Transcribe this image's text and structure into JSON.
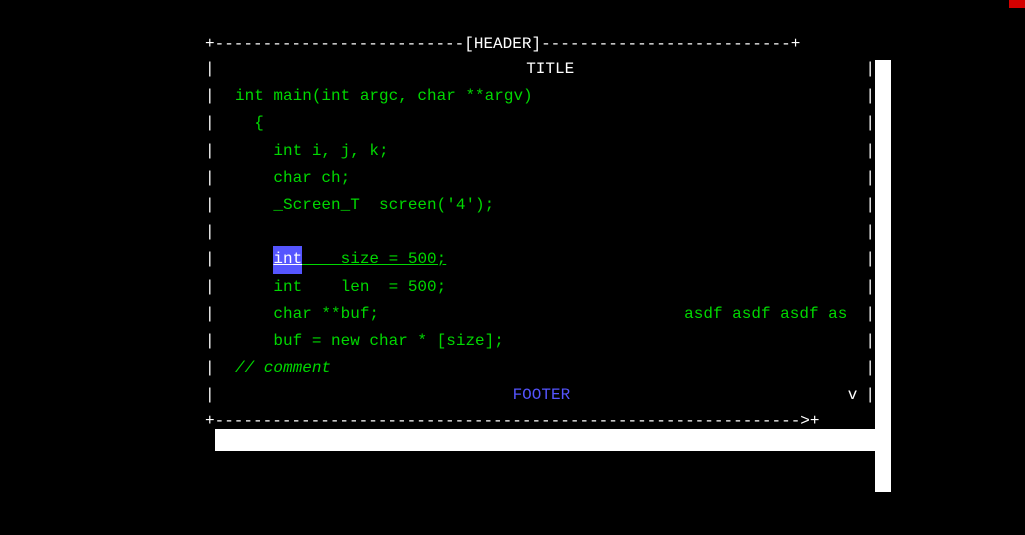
{
  "header": {
    "label": "[HEADER]"
  },
  "title": "TITLE",
  "footer": "FOOTER",
  "scroll_down": "v",
  "code": {
    "line1": "int main(int argc, char **argv)",
    "line2": "  {",
    "line3": "    int i, j, k;",
    "line4": "    char ch;",
    "line5": "    _Screen_T  screen('4');",
    "line6": "",
    "line7_int": "int",
    "line7_rest": "    size = 500;",
    "line8": "    int    len  = 500;",
    "line9a": "    char **buf;",
    "line9b": "asdf asdf asdf as",
    "line10": "    buf = new char * [size];",
    "line11": "// comment"
  },
  "border": {
    "top_left": "+--------------------------",
    "top_right": "--------------------------+",
    "bottom": "+------------------------------------------------------------->+"
  }
}
